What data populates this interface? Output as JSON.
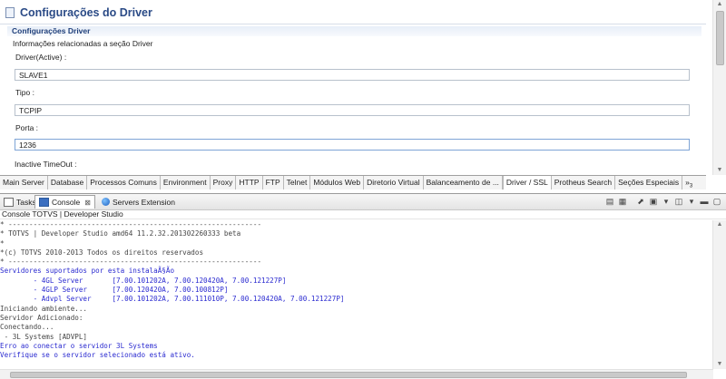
{
  "editor": {
    "title": "Configurações do Driver",
    "section": {
      "title": "Configurações Driver",
      "description": "Informações relacionadas a seção Driver"
    },
    "fields": [
      {
        "label": "Driver(Active) :",
        "value": "SLAVE1"
      },
      {
        "label": "Tipo :",
        "value": "TCPIP"
      },
      {
        "label": "Porta :",
        "value": "1236"
      },
      {
        "label": "Inactive TimeOut :"
      }
    ]
  },
  "page_tabs": [
    "Main Server",
    "Database",
    "Processos Comuns",
    "Environment",
    "Proxy",
    "HTTP",
    "FTP",
    "Telnet",
    "Módulos Web",
    "Diretorio Virtual",
    "Balanceamento de ...",
    "Driver / SSL",
    "Protheus Search",
    "Seções Especiais"
  ],
  "page_tabs_active": "Driver / SSL",
  "page_tabs_more": "»",
  "page_tabs_more_count": "3",
  "view_tabs": {
    "tasks": "Tasks",
    "console": "Console",
    "console_close": "⊠",
    "servers": "Servers Extension"
  },
  "console_title": "Console TOTVS | Developer Studio",
  "console_lines": [
    {
      "text": "* -------------------------------------------------------------",
      "color": "gray"
    },
    {
      "text": "* TOTVS | Developer Studio amd64 11.2.32.201302260333 beta",
      "color": "gray"
    },
    {
      "text": "*",
      "color": "gray"
    },
    {
      "text": "*(c) TOTVS 2010-2013 Todos os direitos reservados",
      "color": "gray"
    },
    {
      "text": "* -------------------------------------------------------------",
      "color": "gray"
    },
    {
      "text": "Servidores suportados por esta instalaÃ§Ão",
      "color": "blue"
    },
    {
      "text": "        - 4GL Server       [7.00.101202A, 7.00.120420A, 7.00.121227P]",
      "color": "blue"
    },
    {
      "text": "        - 4GLP Server      [7.00.120420A, 7.00.100812P]",
      "color": "blue"
    },
    {
      "text": "        - Advpl Server     [7.00.101202A, 7.00.111010P, 7.00.120420A, 7.00.121227P]",
      "color": "blue"
    },
    {
      "text": "Iniciando ambiente...",
      "color": "gray"
    },
    {
      "text": "Servidor Adicionado:",
      "color": "gray"
    },
    {
      "text": "Conectando...",
      "color": "gray"
    },
    {
      "text": " - 3L Systems [ADVPL]",
      "color": "gray"
    },
    {
      "text": "Erro ao conectar o servidor 3L Systems",
      "color": "blue"
    },
    {
      "text": "Verifique se o servidor selecionado está ativo.",
      "color": "blue"
    }
  ],
  "colors": {
    "title": "#2a4a86",
    "console_blue": "#2a2ad0",
    "console_gray": "#444444"
  },
  "icons": [
    "editor-icon",
    "tasks-icon",
    "console-icon",
    "servers-globe-icon",
    "toolbar-icons"
  ]
}
